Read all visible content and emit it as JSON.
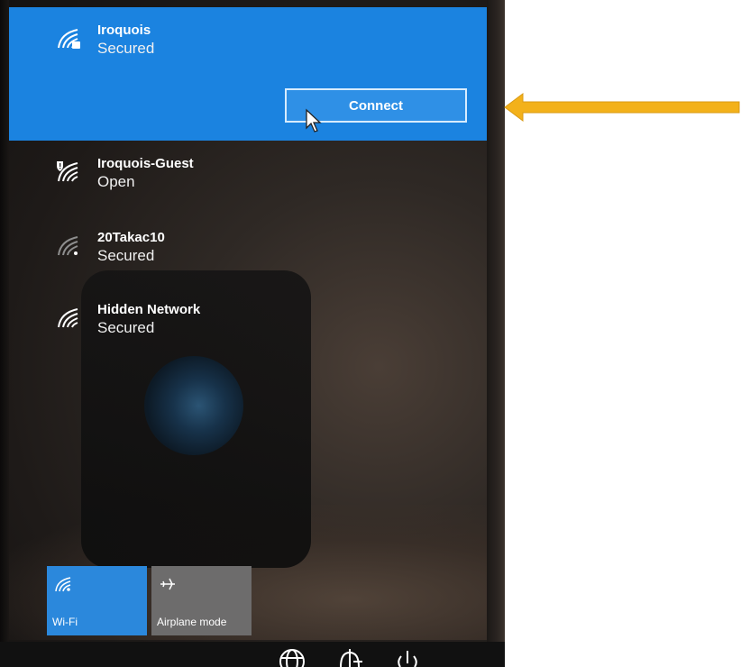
{
  "networks": [
    {
      "name": "Iroquois",
      "status": "Secured",
      "icon": "wifi-secured-icon",
      "selected": true
    },
    {
      "name": "Iroquois-Guest",
      "status": "Open",
      "icon": "wifi-shield-warning-icon"
    },
    {
      "name": "20Takac10",
      "status": "Secured",
      "icon": "wifi-weak-icon"
    },
    {
      "name": "Hidden Network",
      "status": "Secured",
      "icon": "wifi-icon"
    }
  ],
  "connect_label": "Connect",
  "quick_actions": [
    {
      "label": "Wi-Fi",
      "icon": "wifi-icon",
      "active": true
    },
    {
      "label": "Airplane mode",
      "icon": "airplane-icon",
      "active": false
    }
  ],
  "system_icons": [
    "globe-icon",
    "shield-arrow-icon",
    "power-icon"
  ],
  "colors": {
    "accent": "#1b83e0",
    "tile_inactive": "#6d6c6c",
    "arrow": "#f3b11a"
  }
}
